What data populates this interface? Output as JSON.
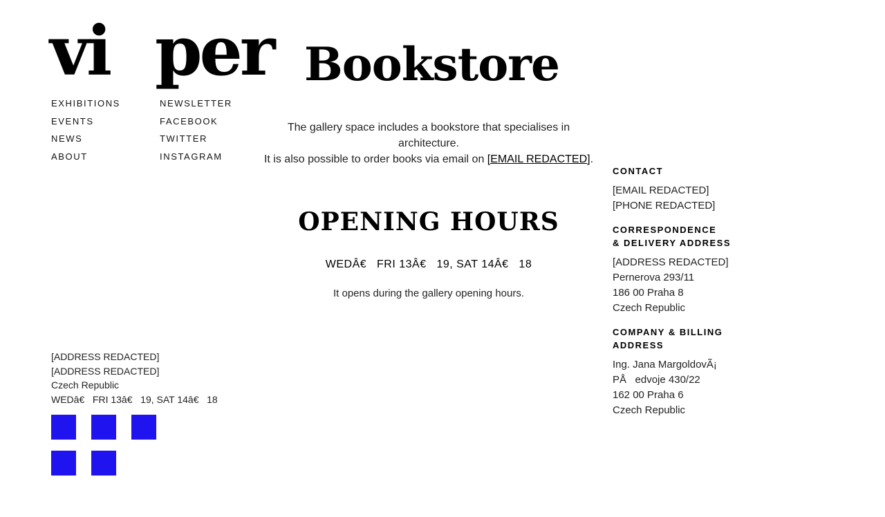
{
  "logo": {
    "part1": "vi",
    "part2": "per"
  },
  "nav": {
    "left": [
      "EXHIBITIONS",
      "EVENTS",
      "NEWS",
      "ABOUT"
    ],
    "right": [
      "NEWSLETTER",
      "FACEBOOK",
      "TWITTER",
      "INSTAGRAM"
    ]
  },
  "main": {
    "title": "Bookstore",
    "intro_line1": "The gallery space includes a bookstore that specialises in architecture.",
    "intro_line2_prefix": "It is also possible to order books via email on ",
    "intro_email": "[EMAIL REDACTED]",
    "intro_line2_suffix": ".",
    "hours_heading": "OPENING HOURS",
    "hours_text": "WEDÂ€   FRI 13Â€   19, SAT 14Â€   18",
    "hours_note": "It opens during the gallery opening hours."
  },
  "footer": {
    "lines": [
      "[ADDRESS REDACTED]",
      "[ADDRESS REDACTED]",
      "Czech Republic",
      "WEDâ€   FRI 13â€   19, SAT 14â€   18"
    ],
    "social_icons": [
      "social-icon-1",
      "social-icon-2",
      "social-icon-3",
      "social-icon-4",
      "social-icon-5"
    ],
    "social_color": "#1f14f0"
  },
  "sidebar": {
    "contact_heading": "CONTACT",
    "contact_lines": [
      "[EMAIL REDACTED]",
      "[PHONE REDACTED]"
    ],
    "correspondence_heading_1": "CORRESPONDENCE",
    "correspondence_heading_2": "& DELIVERY ADDRESS",
    "correspondence_lines": [
      "[ADDRESS REDACTED]",
      "Pernerova 293/11",
      "186 00 Praha 8",
      "Czech Republic"
    ],
    "billing_heading_1": "COMPANY & BILLING",
    "billing_heading_2": "ADDRESS",
    "billing_lines": [
      "Ing. Jana MargoldovÃ¡",
      "PÅ   edvoje 430/22",
      "162 00 Praha 6",
      "Czech Republic"
    ]
  }
}
